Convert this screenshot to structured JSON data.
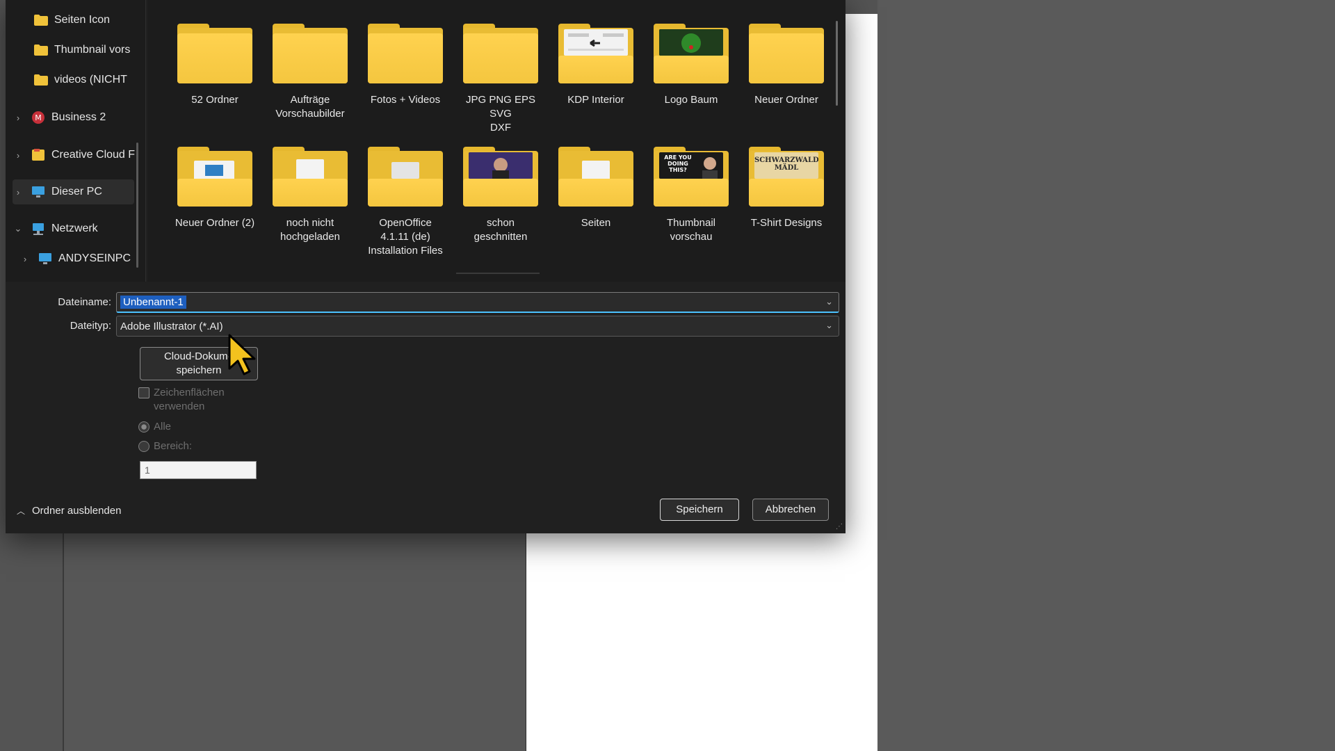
{
  "nav": {
    "items": [
      {
        "label": "Seiten Icon",
        "icon": "folder-icon",
        "expandable": false
      },
      {
        "label": "Thumbnail vors",
        "icon": "folder-icon",
        "expandable": false
      },
      {
        "label": "videos (NICHT",
        "icon": "folder-icon",
        "expandable": false
      },
      {
        "label": "Business 2",
        "icon": "business-icon",
        "expandable": true
      },
      {
        "label": "Creative Cloud F",
        "icon": "creative-cloud-folder-icon",
        "expandable": true
      },
      {
        "label": "Dieser PC",
        "icon": "computer-icon",
        "expandable": true,
        "selected": true
      },
      {
        "label": "Netzwerk",
        "icon": "network-icon",
        "expandable": true,
        "expanded": true
      },
      {
        "label": "ANDYSEINPC",
        "icon": "computer-icon",
        "expandable": true
      }
    ]
  },
  "folders": {
    "row1": [
      {
        "label": "52 Ordner"
      },
      {
        "label": "Aufträge\nVorschaubilder"
      },
      {
        "label": "Fotos + Videos"
      },
      {
        "label": "JPG PNG EPS SVG\nDXF"
      },
      {
        "label": "KDP Interior",
        "thumb": "document"
      },
      {
        "label": "Logo Baum",
        "thumb": "green"
      },
      {
        "label": "Neuer Ordner"
      }
    ],
    "row2": [
      {
        "label": "Neuer Ordner (2)",
        "thumb": "blue-doc"
      },
      {
        "label": "noch nicht\nhochgeladen",
        "thumb": "paper"
      },
      {
        "label": "OpenOffice\n4.1.11 (de)\nInstallation Files",
        "thumb": "paper"
      },
      {
        "label": "schon\ngeschnitten",
        "thumb": "purple"
      },
      {
        "label": "Seiten",
        "thumb": "paper"
      },
      {
        "label": "Thumbnail\nvorschau",
        "thumb": "video",
        "thumb_text": "ARE YOU DOING THIS?"
      },
      {
        "label": "T-Shirt Designs",
        "thumb": "text",
        "thumb_text": "SCHWARZWALD MÄDL"
      }
    ]
  },
  "form": {
    "filename_label": "Dateiname:",
    "filename_value": "Unbenannt-1",
    "filetype_label": "Dateityp:",
    "filetype_value": "Adobe Illustrator (*.AI)",
    "cloud_button": "Cloud-Dokume\nspeichern",
    "artboards_label": "Zeichenflächen\nverwenden",
    "all_label": "Alle",
    "range_label": "Bereich:",
    "range_value": "1"
  },
  "footer": {
    "hide_folders": "Ordner ausblenden",
    "save": "Speichern",
    "cancel": "Abbrechen"
  },
  "colors": {
    "folder": "#f4c63f",
    "selection": "#1e5fbf",
    "dialog_bg": "#202020",
    "canvas_bg": "#535353"
  }
}
